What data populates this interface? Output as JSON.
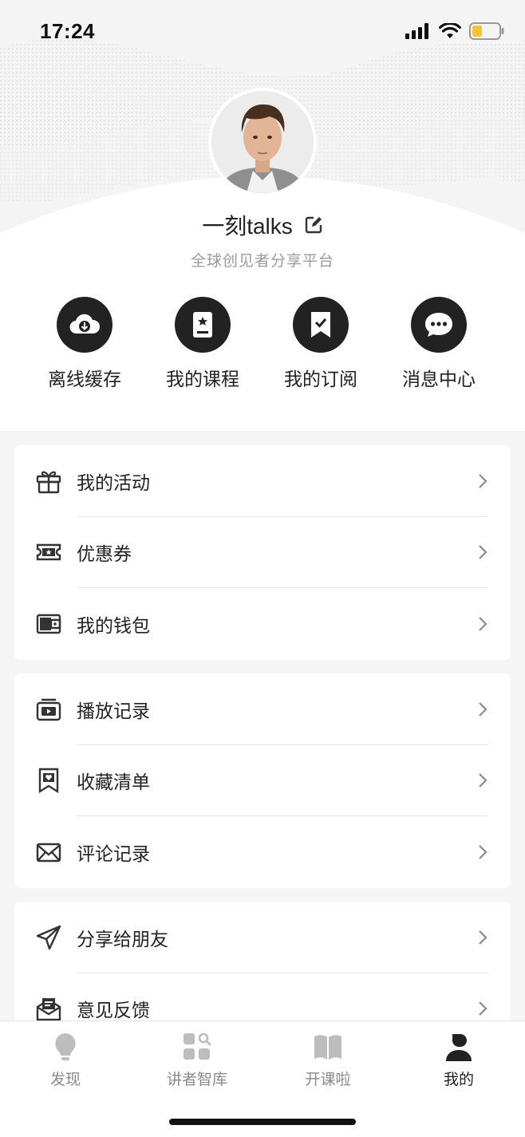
{
  "status_bar": {
    "time": "17:24",
    "battery_color": "#f3c531"
  },
  "profile": {
    "name": "一刻talks",
    "subtitle": "全球创见者分享平台"
  },
  "quick_actions": [
    {
      "label": "离线缓存",
      "icon": "cloud-download-icon"
    },
    {
      "label": "我的课程",
      "icon": "book-star-icon"
    },
    {
      "label": "我的订阅",
      "icon": "bookmark-check-icon"
    },
    {
      "label": "消息中心",
      "icon": "chat-bubble-icon"
    }
  ],
  "groups": [
    [
      {
        "label": "我的活动",
        "icon": "gift-icon"
      },
      {
        "label": "优惠券",
        "icon": "ticket-icon"
      },
      {
        "label": "我的钱包",
        "icon": "wallet-icon"
      }
    ],
    [
      {
        "label": "播放记录",
        "icon": "play-history-icon"
      },
      {
        "label": "收藏清单",
        "icon": "bookmark-heart-icon"
      },
      {
        "label": "评论记录",
        "icon": "envelope-icon"
      }
    ],
    [
      {
        "label": "分享给朋友",
        "icon": "send-icon"
      },
      {
        "label": "意见反馈",
        "icon": "feedback-mail-icon"
      }
    ]
  ],
  "tabbar": [
    {
      "label": "发现",
      "icon": "lightbulb-icon",
      "active": false
    },
    {
      "label": "讲者智库",
      "icon": "grid-search-icon",
      "active": false
    },
    {
      "label": "开课啦",
      "icon": "open-book-icon",
      "active": false
    },
    {
      "label": "我的",
      "icon": "person-icon",
      "active": true
    }
  ],
  "colors": {
    "accent": "#222222",
    "muted": "#9a9a9a",
    "background": "#f5f5f5"
  }
}
